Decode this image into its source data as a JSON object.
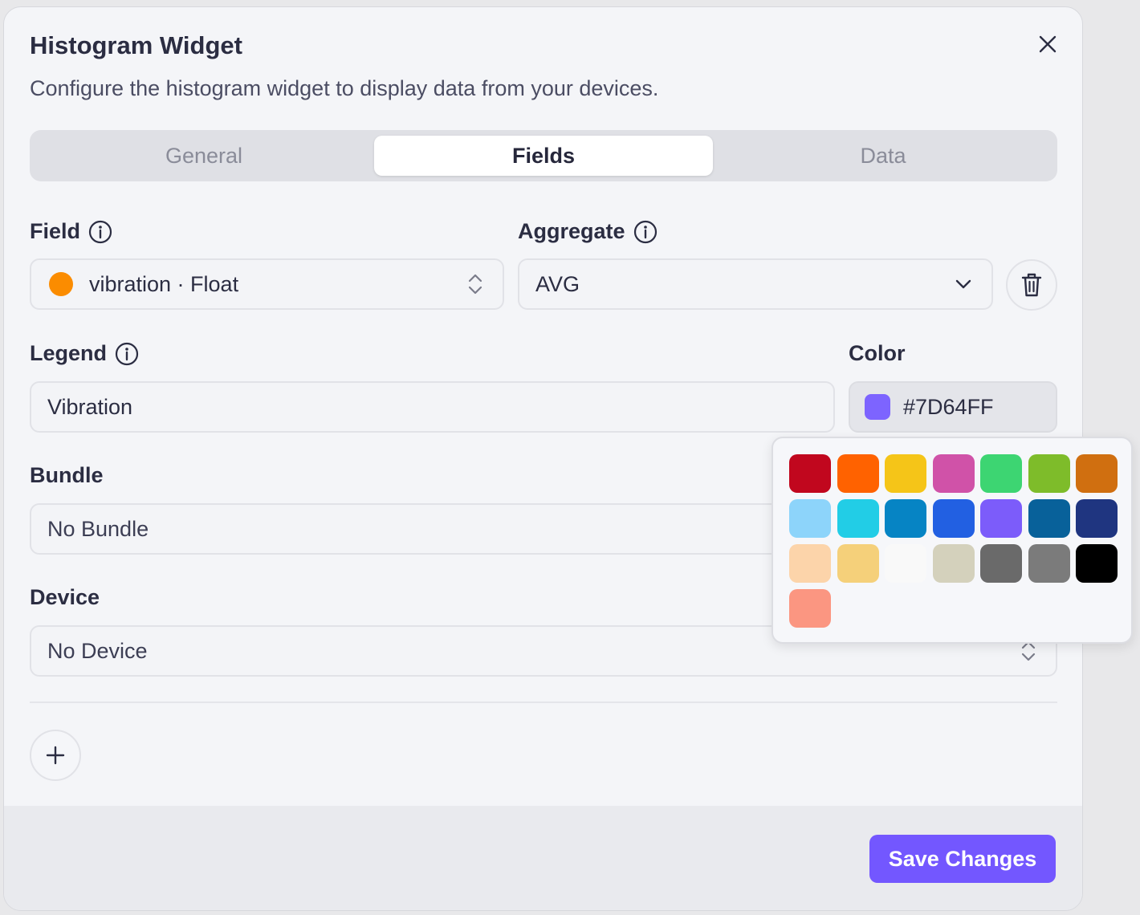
{
  "dialog": {
    "title": "Histogram Widget",
    "subtitle": "Configure the histogram widget to display data from your devices."
  },
  "tabs": [
    {
      "label": "General",
      "active": false
    },
    {
      "label": "Fields",
      "active": true
    },
    {
      "label": "Data",
      "active": false
    }
  ],
  "field": {
    "label": "Field",
    "value": "vibration · Float",
    "dot_color": "#FB8C00"
  },
  "aggregate": {
    "label": "Aggregate",
    "value": "AVG"
  },
  "legend": {
    "label": "Legend",
    "value": "Vibration"
  },
  "color": {
    "label": "Color",
    "value": "#7D64FF"
  },
  "bundle": {
    "label": "Bundle",
    "value": "No Bundle"
  },
  "device": {
    "label": "Device",
    "value": "No Device"
  },
  "palette": [
    "#C1071E",
    "#FF6200",
    "#F5C518",
    "#D052A8",
    "#3DD572",
    "#7EBC2A",
    "#D06F10",
    "#8DD4FA",
    "#22CDE6",
    "#0684C4",
    "#2260E2",
    "#7C5CFA",
    "#08619A",
    "#1F3580",
    "#FCD4AA",
    "#F5D07A",
    "#F9F9F9",
    "#D4D1BC",
    "#6A6A6A",
    "#7B7B7B",
    "#000000",
    "#FB9681"
  ],
  "footer": {
    "save_label": "Save Changes"
  },
  "accent_color": "#7357FF"
}
